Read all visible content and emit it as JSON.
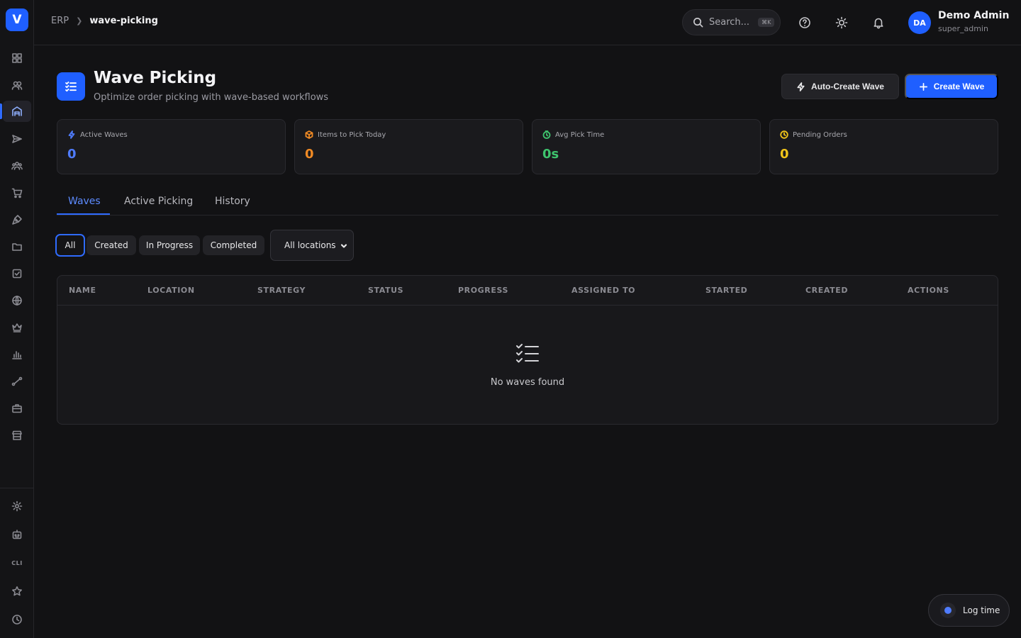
{
  "app": {
    "logo_letter": "V"
  },
  "breadcrumb": {
    "root": "ERP",
    "current": "wave-picking"
  },
  "search": {
    "placeholder": "Search...",
    "shortcut": "⌘K"
  },
  "user": {
    "initials": "DA",
    "name": "Demo Admin",
    "role": "super_admin"
  },
  "header": {
    "title": "Wave Picking",
    "subtitle": "Optimize order picking with wave-based workflows"
  },
  "actions": {
    "auto_create": "Auto-Create Wave",
    "create": "Create Wave"
  },
  "stats": [
    {
      "label": "Active Waves",
      "value": "0",
      "color": "#4f7cff",
      "icon": "bolt-icon"
    },
    {
      "label": "Items to Pick Today",
      "value": "0",
      "color": "#f08a24",
      "icon": "package-icon"
    },
    {
      "label": "Avg Pick Time",
      "value": "0s",
      "color": "#3ec46d",
      "icon": "timer-icon"
    },
    {
      "label": "Pending Orders",
      "value": "0",
      "color": "#f0c419",
      "icon": "clock-icon"
    }
  ],
  "tabs": [
    {
      "label": "Waves"
    },
    {
      "label": "Active Picking"
    },
    {
      "label": "History"
    }
  ],
  "filters": {
    "chips": [
      "All",
      "Created",
      "In Progress",
      "Completed"
    ],
    "location_select": "All locations"
  },
  "table": {
    "columns": [
      "NAME",
      "LOCATION",
      "STRATEGY",
      "STATUS",
      "PROGRESS",
      "ASSIGNED TO",
      "STARTED",
      "CREATED",
      "ACTIONS"
    ],
    "empty_message": "No waves found"
  },
  "sidebar": {
    "cli_label": "CLI"
  },
  "log_time": {
    "label": "Log time"
  }
}
